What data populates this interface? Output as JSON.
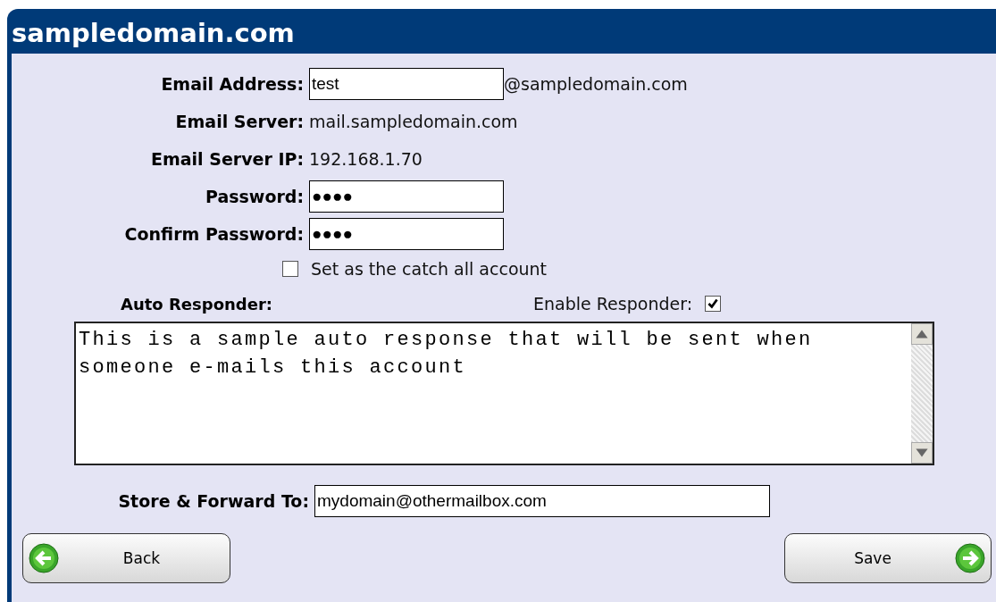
{
  "header": {
    "title": "sampledomain.com"
  },
  "fields": [
    {
      "kind": "input",
      "label": "Email Address:",
      "value": "test",
      "suffix": "@sampledomain.com"
    },
    {
      "kind": "text",
      "label": "Email Server:",
      "value": "mail.sampledomain.com"
    },
    {
      "kind": "text",
      "label": "Email Server IP:",
      "value": "192.168.1.70"
    },
    {
      "kind": "input",
      "label": "Password:",
      "value": "●●●●"
    },
    {
      "kind": "input",
      "label": "Confirm Password:",
      "value": "●●●●"
    }
  ],
  "catch_all": {
    "label": "Set as the catch all account",
    "checked": false
  },
  "auto_responder": {
    "label": "Auto Responder:",
    "enable_label": "Enable Responder:",
    "enabled": true,
    "message": "This is a sample auto response that will be sent when\nsomeone e-mails this account"
  },
  "forward": {
    "label": "Store & Forward To:",
    "value": "mydomain@othermailbox.com"
  },
  "buttons": [
    {
      "kind": "back",
      "label": "Back"
    },
    {
      "kind": "save",
      "label": "Save"
    }
  ]
}
